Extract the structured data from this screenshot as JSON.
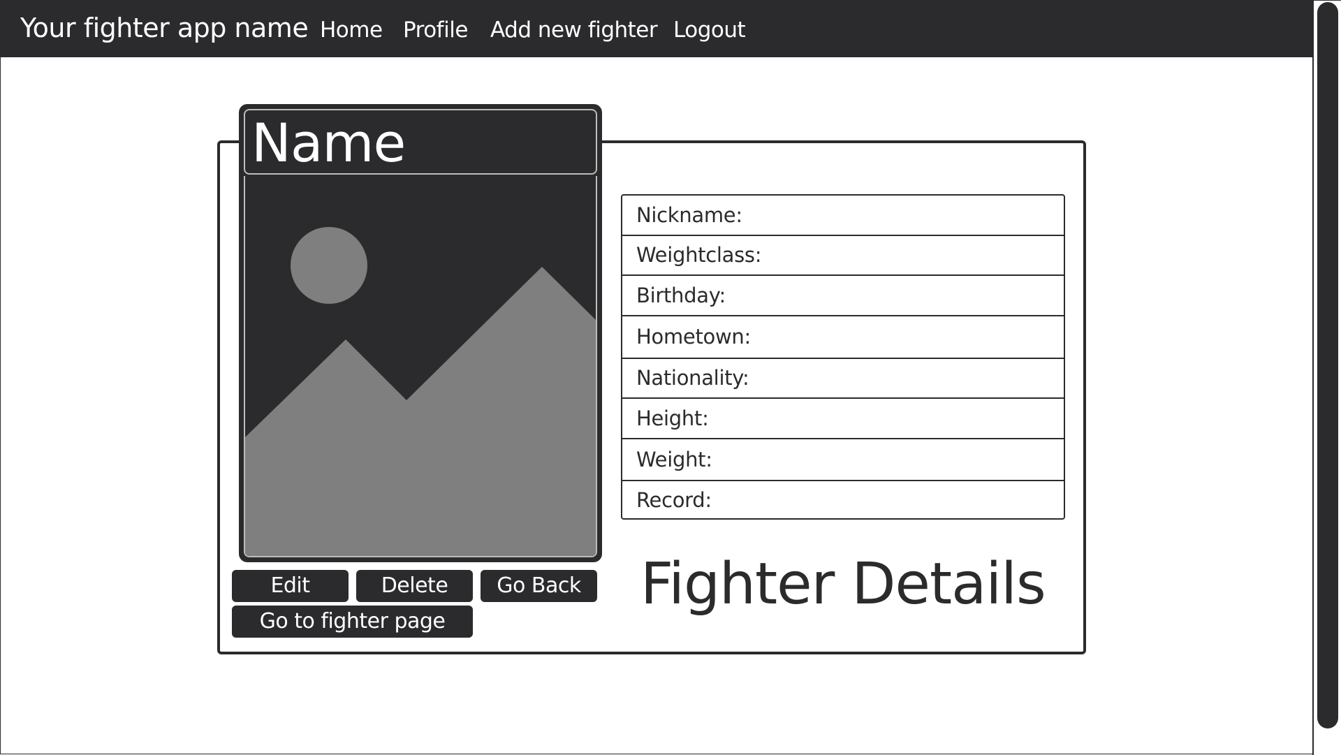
{
  "navbar": {
    "brand": "Your fighter app name",
    "links": [
      {
        "label": "Home"
      },
      {
        "label": "Profile"
      },
      {
        "label": "Add new fighter"
      },
      {
        "label": "Logout"
      }
    ]
  },
  "fighter_card": {
    "name": "Name",
    "image_placeholder": "image-placeholder-icon"
  },
  "fields": [
    {
      "label": "Nickname:"
    },
    {
      "label": "Weightclass:"
    },
    {
      "label": "Birthday:"
    },
    {
      "label": "Hometown:"
    },
    {
      "label": "Nationality:"
    },
    {
      "label": "Height:"
    },
    {
      "label": "Weight:"
    },
    {
      "label": "Record:"
    }
  ],
  "actions": {
    "edit": "Edit",
    "delete": "Delete",
    "go_back": "Go Back",
    "go_to_fighter_page": "Go to fighter page"
  },
  "page_heading": "Fighter Details",
  "colors": {
    "dark": "#2b2b2d",
    "placeholder_gray": "#7f7f7f",
    "background": "#ffffff"
  }
}
